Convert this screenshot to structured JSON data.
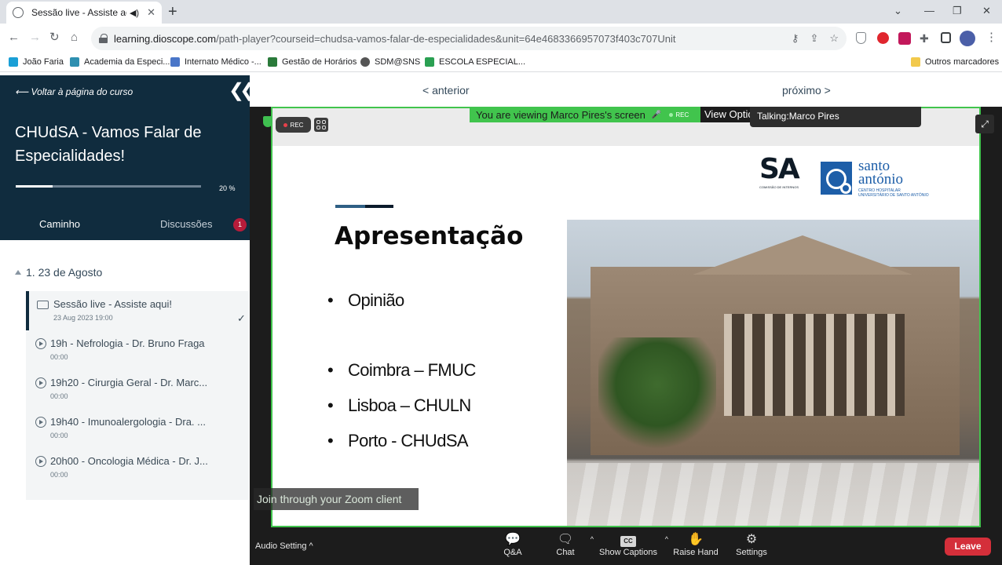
{
  "browser": {
    "tab_title": "Sessão live - Assiste aqui!",
    "url_host": "learning.dioscope.com",
    "url_path": "/path-player?courseid=chudsa-vamos-falar-de-especialidades&unit=64e4683366957073f403c707Unit",
    "bookmarks": [
      {
        "label": "João Faria",
        "color": "#1a9fd6"
      },
      {
        "label": "Academia da Especi...",
        "color": "#2e8fb0"
      },
      {
        "label": "Internato Médico -...",
        "color": "#4a76c8"
      },
      {
        "label": "Gestão de Horários",
        "color": "#2a7a3a"
      },
      {
        "label": "SDM@SNS",
        "color": "#555555"
      },
      {
        "label": "ESCOLA ESPECIAL...",
        "color": "#2aa052"
      }
    ],
    "other_bookmarks": "Outros marcadores"
  },
  "sidebar": {
    "back_label": "⟵ Voltar à página do curso",
    "course_title": "CHUdSA - Vamos Falar de Especialidades!",
    "progress_pct": 20,
    "progress_label": "20 %",
    "tab_path": "Caminho",
    "tab_discussions": "Discussões",
    "discussions_badge": "1",
    "section_title": "1. 23 de Agosto",
    "lessons": [
      {
        "title": "Sessão live - Assiste aqui!",
        "sub": "23 Aug 2023 19:00",
        "check": "✓"
      },
      {
        "title": "19h - Nefrologia - Dr. Bruno Fraga",
        "sub": "00:00"
      },
      {
        "title": "19h20 - Cirurgia Geral - Dr. Marc...",
        "sub": "00:00"
      },
      {
        "title": "19h40 - Imunoalergologia - Dra. ...",
        "sub": "00:00"
      },
      {
        "title": "20h00 - Oncologia Médica - Dr. J...",
        "sub": "00:00"
      }
    ]
  },
  "player": {
    "prev_label": "< anterior",
    "next_label": "próximo >",
    "rec_label": "REC",
    "viewing_banner": "You are viewing Marco Pires's screen",
    "banner_rec": "REC",
    "view_options": "View Options",
    "talking": "Talking:Marco Pires",
    "join_zoom": "Join through your Zoom client"
  },
  "slide": {
    "title": "Apresentação",
    "bullets": [
      "Opinião",
      "Coimbra – FMUC",
      "Lisboa – CHULN",
      "Porto - CHUdSA"
    ],
    "logo_sa_text": "SA",
    "logo_sa_sub": "COMISSÃO DE INTERNOS",
    "logo_santo_name1": "santo",
    "logo_santo_name2": "antónio",
    "logo_santo_sub": "CENTRO HOSPITALAR UNIVERSITÁRIO DE SANTO ANTÓNIO"
  },
  "controls": {
    "audio_setting": "Audio Setting ^",
    "qa": "Q&A",
    "chat": "Chat",
    "captions": "Show Captions",
    "cc": "CC",
    "raise_hand": "Raise Hand",
    "settings": "Settings",
    "leave": "Leave"
  }
}
